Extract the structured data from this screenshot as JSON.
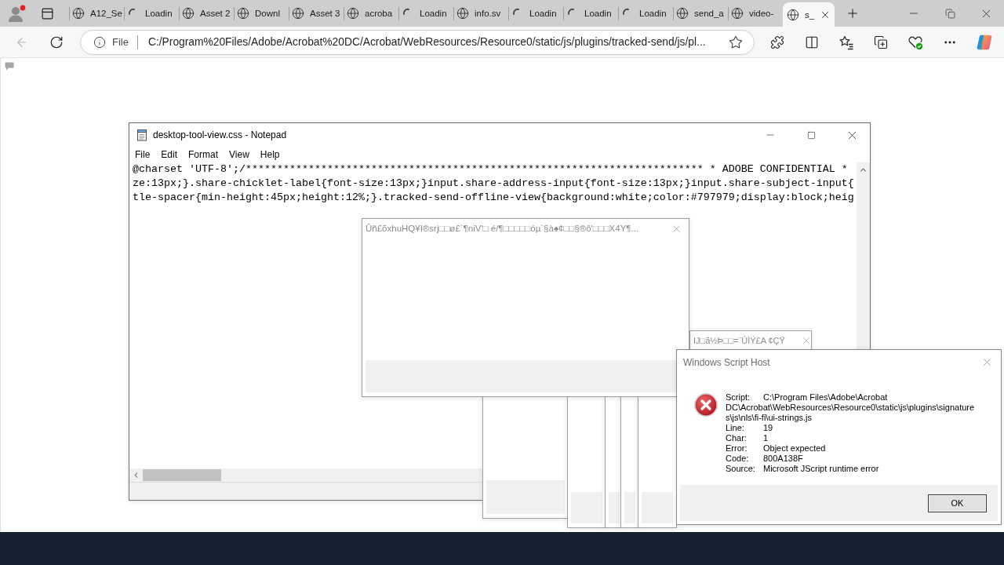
{
  "browser": {
    "tabs": [
      {
        "kind": "page",
        "title": "A12_Se",
        "selected": false
      },
      {
        "kind": "loading",
        "title": "Loadin",
        "selected": false
      },
      {
        "kind": "page",
        "title": "Asset 2",
        "selected": false
      },
      {
        "kind": "page",
        "title": "Downl",
        "selected": false
      },
      {
        "kind": "page",
        "title": "Asset 3",
        "selected": false
      },
      {
        "kind": "page",
        "title": "acroba",
        "selected": false
      },
      {
        "kind": "loading",
        "title": "Loadin",
        "selected": false
      },
      {
        "kind": "page",
        "title": "info.sv",
        "selected": false
      },
      {
        "kind": "loading",
        "title": "Loadin",
        "selected": false
      },
      {
        "kind": "loading",
        "title": "Loadin",
        "selected": false
      },
      {
        "kind": "loading",
        "title": "Loadin",
        "selected": false
      },
      {
        "kind": "page",
        "title": "send_a",
        "selected": false
      },
      {
        "kind": "page",
        "title": "video-",
        "selected": false
      },
      {
        "kind": "page",
        "title": "s_",
        "selected": true
      }
    ],
    "back_button": {
      "disabled": true
    },
    "address_bar": {
      "scheme": "File",
      "url": "C:/Program%20Files/Adobe/Acrobat%20DC/Acrobat/WebResources/Resource0/static/js/plugins/tracked-send/js/pl..."
    }
  },
  "notepad": {
    "title": "desktop-tool-view.css - Notepad",
    "menu": [
      "File",
      "Edit",
      "Format",
      "View",
      "Help"
    ],
    "lines": [
      "@charset 'UTF-8';/************************************************************************* * ADOBE CONFIDENTIAL *",
      "ze:13px;}.share-chicklet-label{font-size:13px;}input.share-address-input{font-size:13px;}input.share-subject-input{",
      "tle-spacer{min-height:45px;height:12%;}.tracked-send-offline-view{background:white;color:#797979;display:block;heig"
    ]
  },
  "error_dialogs": [
    {
      "title": "Ûñ£õxhuHQ¥I®srj□□ø£`¶niV'□ é/¶□□□□□óµ`§à♠¢□□§®ô'□□□X4Y¶..."
    },
    {
      "title": "IJ□ã½Þ□□=¨ÚÌÝ£A ¢ÇŸ"
    }
  ],
  "script_host": {
    "title": "Windows Script Host",
    "details": [
      {
        "label": "Script:",
        "value": "C:\\Program Files\\Adobe\\Acrobat DC\\Acrobat\\WebResources\\Resource0\\static\\js\\plugins\\signatures\\js\\nls\\fi-fi\\ui-strings.js"
      },
      {
        "label": "Line:",
        "value": "19"
      },
      {
        "label": "Char:",
        "value": "1"
      },
      {
        "label": "Error:",
        "value": "Object expected"
      },
      {
        "label": "Code:",
        "value": "800A138F"
      },
      {
        "label": "Source:",
        "value": "Microsoft JScript runtime error"
      }
    ],
    "button": "OK"
  }
}
